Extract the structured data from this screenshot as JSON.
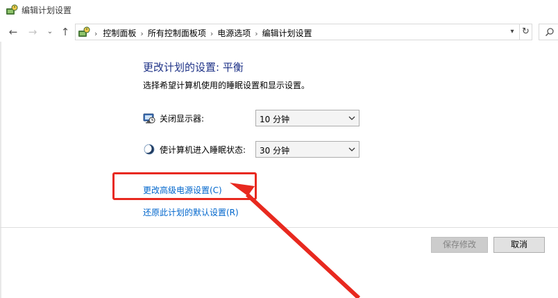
{
  "window": {
    "title": "编辑计划设置",
    "icon": "power-options-icon"
  },
  "nav": {
    "back_icon": "back-arrow-icon",
    "forward_icon": "forward-arrow-icon",
    "recent_icon": "chevron-down-icon",
    "up_icon": "up-arrow-icon",
    "refresh_symbol": "↻",
    "search_icon": "search-icon"
  },
  "breadcrumb": {
    "lead_separator": "›",
    "items": [
      "控制面板",
      "所有控制面板项",
      "电源选项",
      "编辑计划设置"
    ],
    "separator": "›"
  },
  "main": {
    "heading": "更改计划的设置: 平衡",
    "subtext": "选择希望计算机使用的睡眠设置和显示设置。",
    "display_off": {
      "icon": "display-icon",
      "label": "关闭显示器:",
      "value": "10 分钟"
    },
    "sleep": {
      "icon": "moon-icon",
      "label": "使计算机进入睡眠状态:",
      "value": "30 分钟"
    },
    "advanced_link": "更改高级电源设置(C)",
    "restore_link": "还原此计划的默认设置(R)"
  },
  "footer": {
    "save_label": "保存修改",
    "cancel_label": "取消"
  },
  "colors": {
    "heading": "#1e3287",
    "link": "#0066cc",
    "annotation": "#e8291f"
  }
}
